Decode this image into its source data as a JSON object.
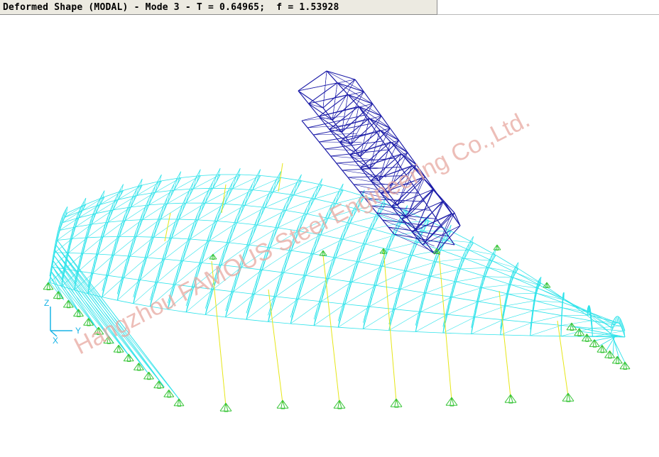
{
  "window": {
    "title": "Deformed Shape (MODAL) - Mode 3 - T = 0.64965;  f = 1.53928"
  },
  "axes": {
    "z_label": "Z",
    "y_label": "Y",
    "x_label": "X"
  },
  "watermark": {
    "text": "Hangzhou FAMOUS Steel Engineering Co.,Ltd."
  },
  "colors": {
    "roof_truss": "#2ee3ea",
    "deformed_tower": "#1c1ca8",
    "columns": "#e6e617",
    "supports": "#39c539",
    "watermark": "#e7a8a0",
    "axis": "#18b4e6"
  }
}
